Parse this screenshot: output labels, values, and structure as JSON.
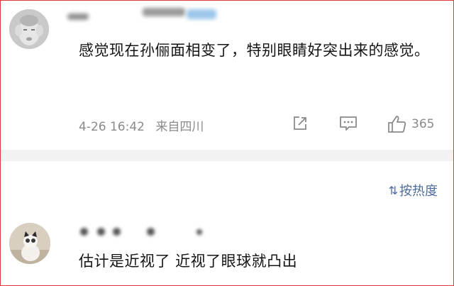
{
  "comments": [
    {
      "text": "感觉现在孙俪面相变了，特别眼睛好突出来的感觉。",
      "date": "4-26 16:42",
      "location": "来自四川",
      "like_count": "365"
    },
    {
      "text": "估计是近视了 近视了眼球就凸出"
    }
  ],
  "sort": {
    "label": "按热度",
    "icon": "sort-icon"
  },
  "icons": {
    "share": "share-icon",
    "reply": "comment-icon",
    "like": "thumbs-up-icon"
  },
  "colors": {
    "border": "#e23a3a",
    "meta_text": "#8a8a8a",
    "sort_link": "#4e6d9a"
  }
}
